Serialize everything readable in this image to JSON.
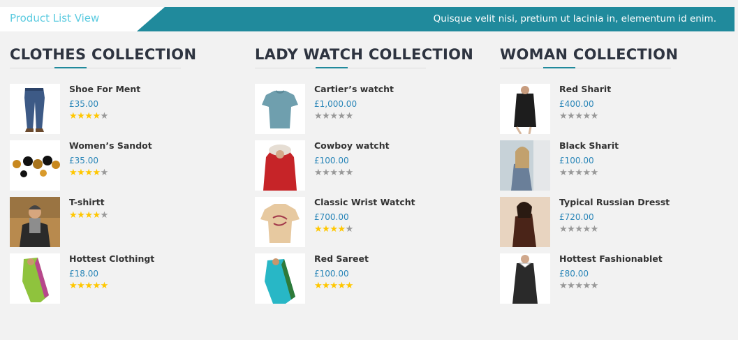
{
  "header": {
    "tab_label": "Product List View",
    "tagline": "Quisque velit nisi, pretium ut lacinia in, elementum id enim."
  },
  "colors": {
    "accent": "#208a9c",
    "price": "#2a86b8",
    "star_on": "#ffc700",
    "star_off": "#999999"
  },
  "collections": [
    {
      "title": "CLOTHES COLLECTION",
      "products": [
        {
          "name": "Shoe For Ment",
          "price": "£35.00",
          "rating": 4,
          "image": "jeans"
        },
        {
          "name": "Women’s Sandot",
          "price": "£35.00",
          "rating": 4,
          "image": "bracelet"
        },
        {
          "name": "T-shirtt",
          "price": "",
          "rating": 4,
          "image": "man-scarf"
        },
        {
          "name": "Hottest Clothingt",
          "price": "£18.00",
          "rating": 5,
          "image": "green-saree"
        }
      ]
    },
    {
      "title": "LADY WATCH COLLECTION",
      "products": [
        {
          "name": "Cartier’s watcht",
          "price": "£1,000.00",
          "rating": 0,
          "image": "blue-tshirt"
        },
        {
          "name": "Cowboy watcht",
          "price": "£100.00",
          "rating": 0,
          "image": "red-jacket"
        },
        {
          "name": "Classic Wrist Watcht",
          "price": "£700.00",
          "rating": 4,
          "image": "beige-tshirt"
        },
        {
          "name": "Red Sareet",
          "price": "£100.00",
          "rating": 5,
          "image": "cyan-saree"
        }
      ]
    },
    {
      "title": "WOMAN COLLECTION",
      "products": [
        {
          "name": "Red Sharit",
          "price": "£400.00",
          "rating": 0,
          "image": "black-coat"
        },
        {
          "name": "Black Sharit",
          "price": "£100.00",
          "rating": 0,
          "image": "woman-photo"
        },
        {
          "name": "Typical Russian Dresst",
          "price": "£720.00",
          "rating": 0,
          "image": "brown-top"
        },
        {
          "name": "Hottest Fashionablet",
          "price": "£80.00",
          "rating": 0,
          "image": "black-dress"
        }
      ]
    }
  ]
}
